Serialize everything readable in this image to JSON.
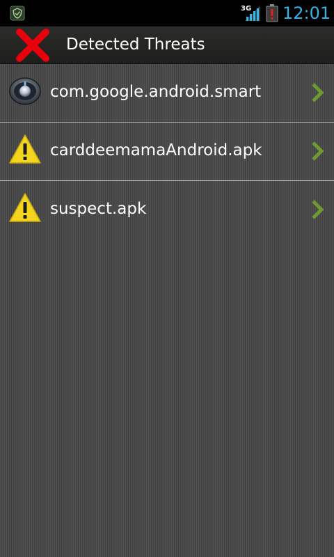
{
  "status_bar": {
    "notification_icon": "shield-app-icon",
    "network_type": "3G",
    "signal_icon": "signal-3g-icon",
    "battery_icon": "battery-alert-icon",
    "time": "12:01",
    "clock_color": "#33b5e5"
  },
  "header": {
    "close_icon": "red-x-icon",
    "title": "Detected Threats"
  },
  "threats": [
    {
      "icon": "app-knob-icon",
      "label": "com.google.android.smart"
    },
    {
      "icon": "warning-icon",
      "label": "carddeemamaAndroid.apk"
    },
    {
      "icon": "warning-icon",
      "label": "suspect.apk"
    }
  ],
  "colors": {
    "chevron": "#6f9a31",
    "warning_fill": "#f2d51c",
    "close_red": "#e8000b"
  }
}
